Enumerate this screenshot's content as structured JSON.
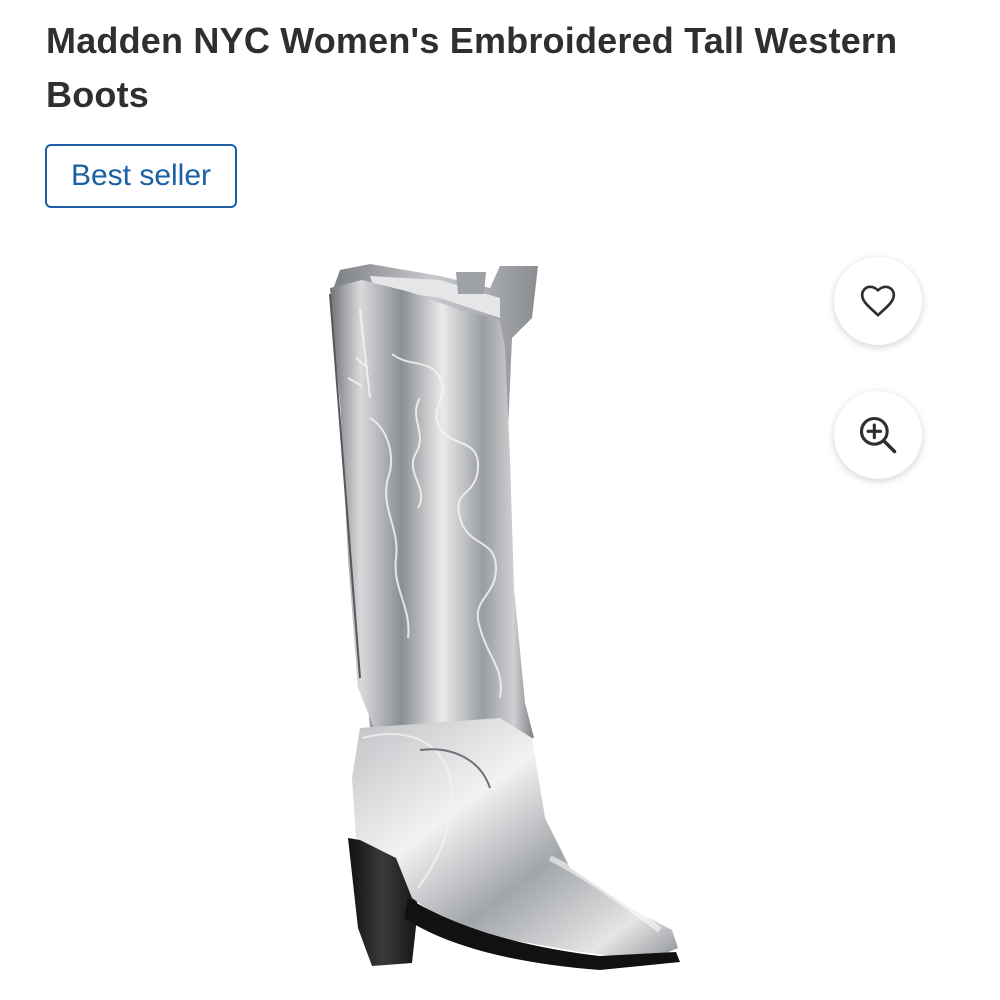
{
  "product": {
    "title": "Madden NYC Women's Embroidered Tall Western Boots",
    "badge": "Best seller"
  },
  "image": {
    "alt": "Silver metallic embroidered tall western boot",
    "actions": {
      "favorite_icon": "heart-icon",
      "zoom_icon": "zoom-in-icon"
    }
  },
  "colors": {
    "badge_border": "#1b5fa6",
    "badge_text": "#1b5fa6",
    "title_text": "#2e2f32"
  }
}
